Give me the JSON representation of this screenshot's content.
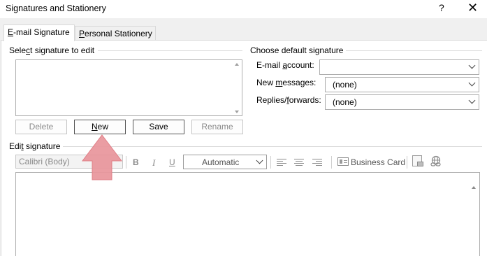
{
  "window": {
    "title": "Signatures and Stationery",
    "help_glyph": "?",
    "close_glyph": "✕"
  },
  "tabs": [
    {
      "label": "E-mail Signature",
      "accel": "E",
      "rest": "-mail Signature",
      "selected": true
    },
    {
      "label": "Personal Stationery",
      "accel": "P",
      "rest": "ersonal Stationery",
      "selected": false
    }
  ],
  "select_signature": {
    "group_label": "Select signature to edit",
    "label_pre": "Sele",
    "label_accel": "c",
    "label_post": "t signature to edit",
    "items": []
  },
  "buttons": {
    "delete": "Delete",
    "new_accel": "N",
    "new_rest": "ew",
    "save": "Save",
    "rename": "Rename"
  },
  "default_signature": {
    "group_label": "Choose default signature",
    "email_account_pre": "E-mail ",
    "email_account_accel": "a",
    "email_account_post": "ccount:",
    "email_account_value": "",
    "new_messages_pre": "New ",
    "new_messages_accel": "m",
    "new_messages_post": "essages:",
    "new_messages_value": "(none)",
    "replies_pre": "Replies/",
    "replies_accel": "f",
    "replies_post": "orwards:",
    "replies_value": "(none)"
  },
  "edit_signature": {
    "group_label_pre": "Edi",
    "group_label_accel": "t",
    "group_label_post": " signature",
    "font": "Calibri (Body)",
    "bold": "B",
    "italic": "I",
    "underline": "U",
    "color": "Automatic",
    "business_card": "Business Card",
    "content": ""
  },
  "colors": {
    "accent_arrow": "#e8959b",
    "dialog_bg": "#f0f0f0"
  }
}
